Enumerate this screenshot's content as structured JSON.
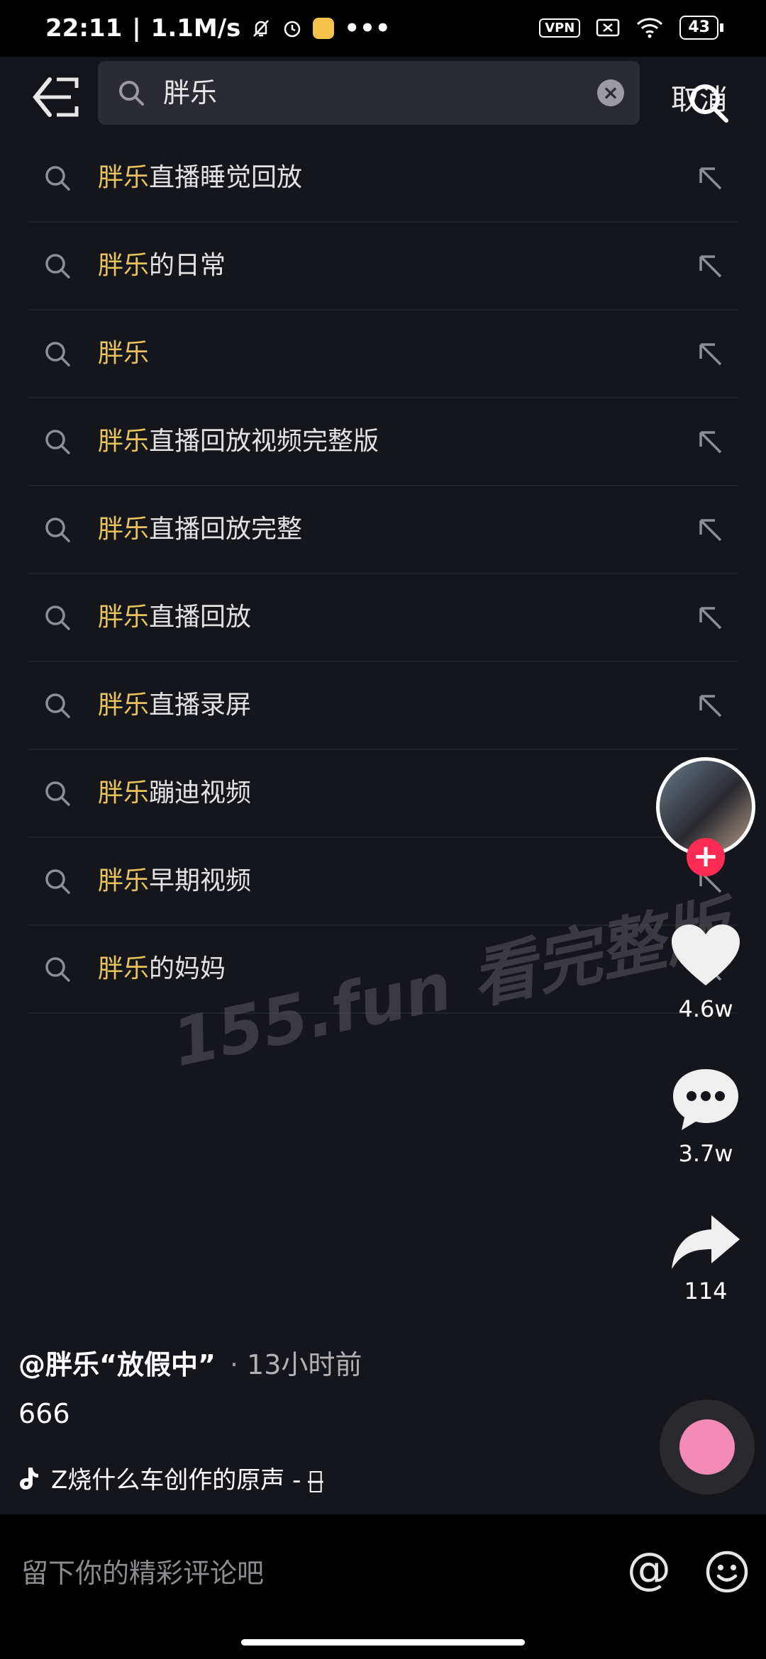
{
  "status_bar": {
    "time": "22:11",
    "network_speed": "1.1M/s",
    "vpn": "VPN",
    "battery": "43"
  },
  "search": {
    "query": "胖乐",
    "cancel_label": "取消"
  },
  "suggestions": [
    {
      "highlight": "胖乐",
      "rest": "直播睡觉回放"
    },
    {
      "highlight": "胖乐",
      "rest": "的日常"
    },
    {
      "highlight": "胖乐",
      "rest": ""
    },
    {
      "highlight": "胖乐",
      "rest": "直播回放视频完整版"
    },
    {
      "highlight": "胖乐",
      "rest": "直播回放完整"
    },
    {
      "highlight": "胖乐",
      "rest": "直播回放"
    },
    {
      "highlight": "胖乐",
      "rest": "直播录屏"
    },
    {
      "highlight": "胖乐",
      "rest": "蹦迪视频"
    },
    {
      "highlight": "胖乐",
      "rest": "早期视频"
    },
    {
      "highlight": "胖乐",
      "rest": "的妈妈"
    }
  ],
  "watermark": "155.fun 看完整版",
  "actions": {
    "likes": "4.6w",
    "comments": "3.7w",
    "shares": "114"
  },
  "video": {
    "author": "@胖乐“放假中”",
    "separator": "·",
    "time_ago": "13小时前",
    "description": "666",
    "music": "Z烧什么车创作的原声 - 叉̶"
  },
  "comment_bar": {
    "placeholder": "留下你的精彩评论吧",
    "at": "@"
  },
  "colors": {
    "highlight": "#e8c25a",
    "follow": "#fe2c55"
  }
}
